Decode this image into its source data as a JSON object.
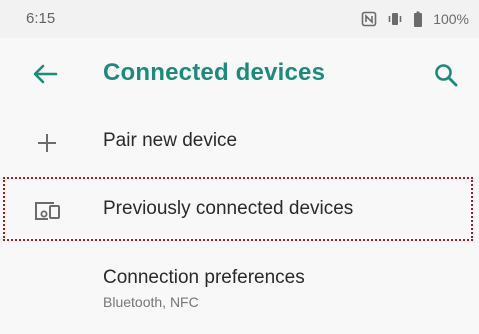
{
  "status_bar": {
    "time": "6:15",
    "battery_percent": "100%",
    "icons": [
      "nfc-icon",
      "vibrate-icon",
      "battery-icon"
    ]
  },
  "toolbar": {
    "title": "Connected devices",
    "back_icon": "arrow-back-icon",
    "search_icon": "search-icon"
  },
  "list": [
    {
      "label": "Pair new device",
      "icon": "plus-icon"
    },
    {
      "label": "Previously connected devices",
      "icon": "devices-icon"
    },
    {
      "label": "Connection preferences",
      "sublabel": "Bluetooth, NFC"
    }
  ],
  "colors": {
    "accent": "#1d8a7c",
    "highlight_border": "#b2191e",
    "background": "#f7f8f7"
  }
}
